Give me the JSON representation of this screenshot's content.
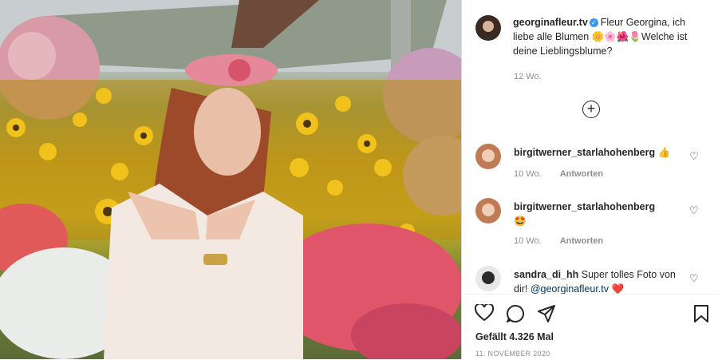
{
  "post": {
    "username": "georginafleur.tv",
    "verified_icon": "verified-badge-icon",
    "caption_text": "Fleur Georgina, ich liebe alle Blumen 🌼🌸🌺🌷Welche ist deine Lieblingsblume?",
    "time": "12 Wo.",
    "load_more_icon": "plus-circle-icon"
  },
  "comments": [
    {
      "username": "birgitwerner_starlahohenberg",
      "text": "👍",
      "time": "10 Wo.",
      "reply": "Antworten"
    },
    {
      "username": "birgitwerner_starlahohenberg",
      "text": "🤩",
      "time": "10 Wo.",
      "reply": "Antworten"
    },
    {
      "username": "sandra_di_hh",
      "text": "Super tolles Foto von dir! ",
      "mention": "@georginafleur.tv",
      "emoji": "❤️"
    }
  ],
  "actions": {
    "icons": [
      "heart-icon",
      "comment-icon",
      "share-icon",
      "bookmark-icon"
    ],
    "likes": "Gefällt 4.326 Mal",
    "date": "11. NOVEMBER 2020"
  },
  "colors": {
    "accent": "#3897f0",
    "text": "#262626",
    "muted": "#8e8e8e",
    "heart": "#ed4956"
  }
}
